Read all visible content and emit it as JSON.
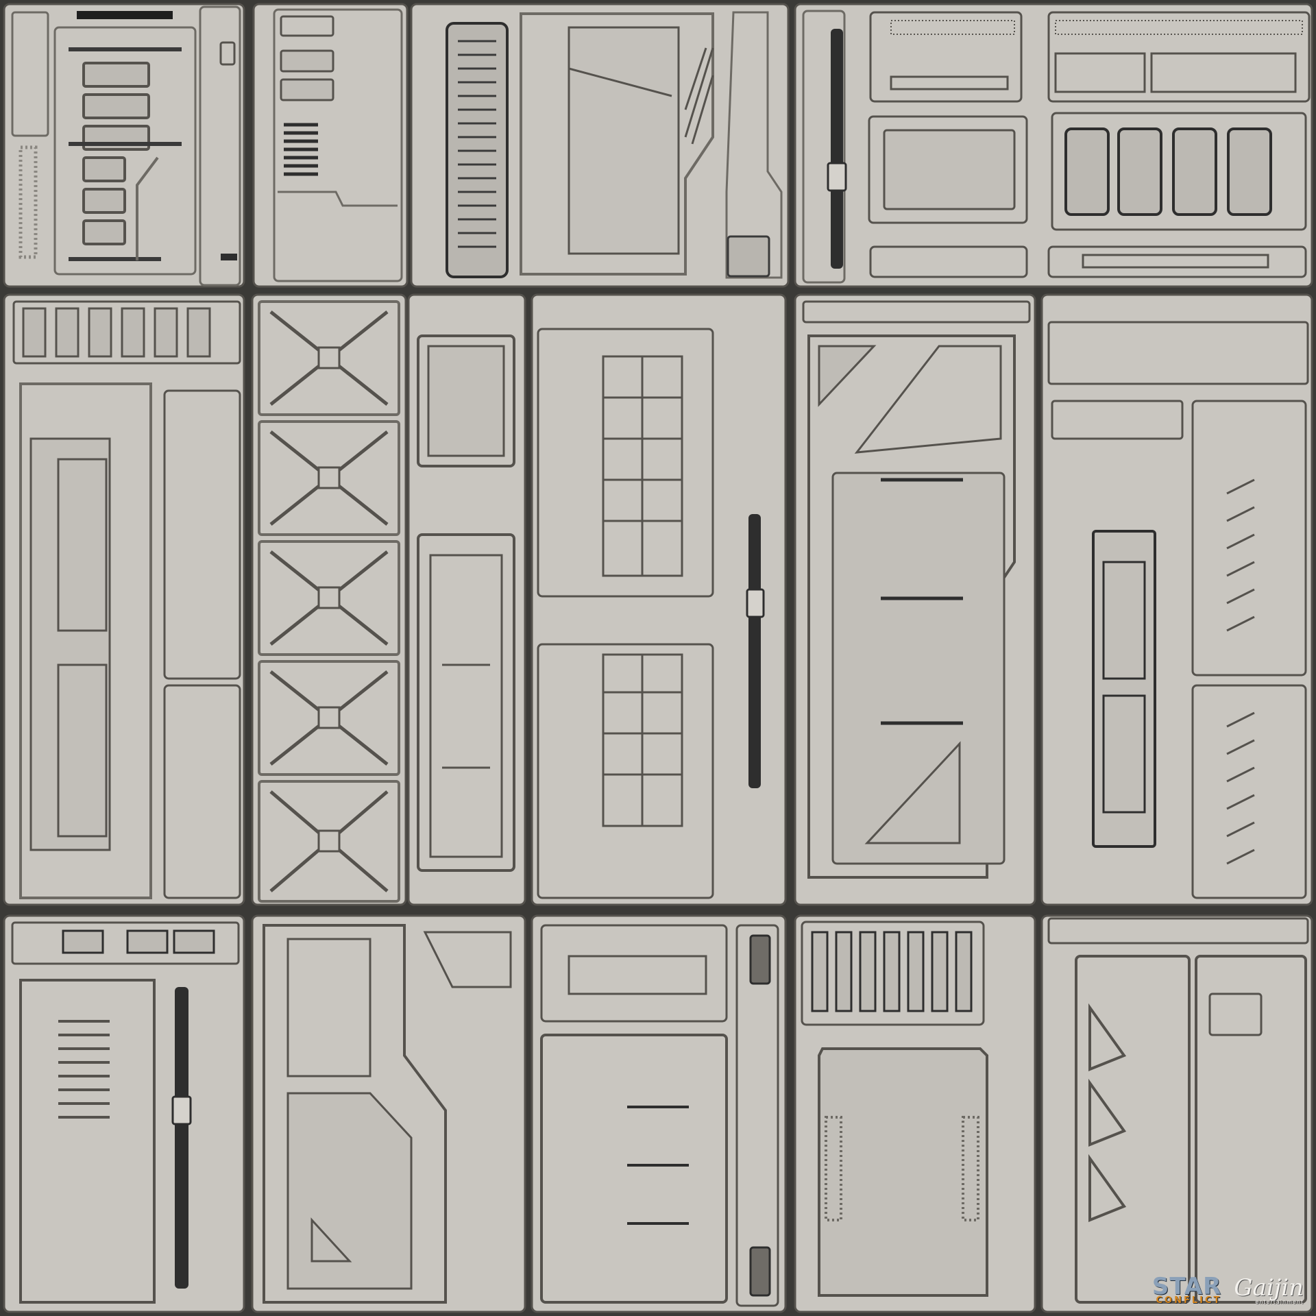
{
  "texture": {
    "base_color": "#c9c6c0",
    "seam_color": "#3b3a37",
    "shadow_color": "#5f5c57",
    "highlight_color": "#e9e7e3",
    "metal_color": "#2e2e2e"
  },
  "logos": {
    "star_conflict": {
      "main": "STAR",
      "sub": "CONFLICT"
    },
    "gaijin": {
      "main": "Gaijin",
      "sub": "entertainment"
    }
  }
}
